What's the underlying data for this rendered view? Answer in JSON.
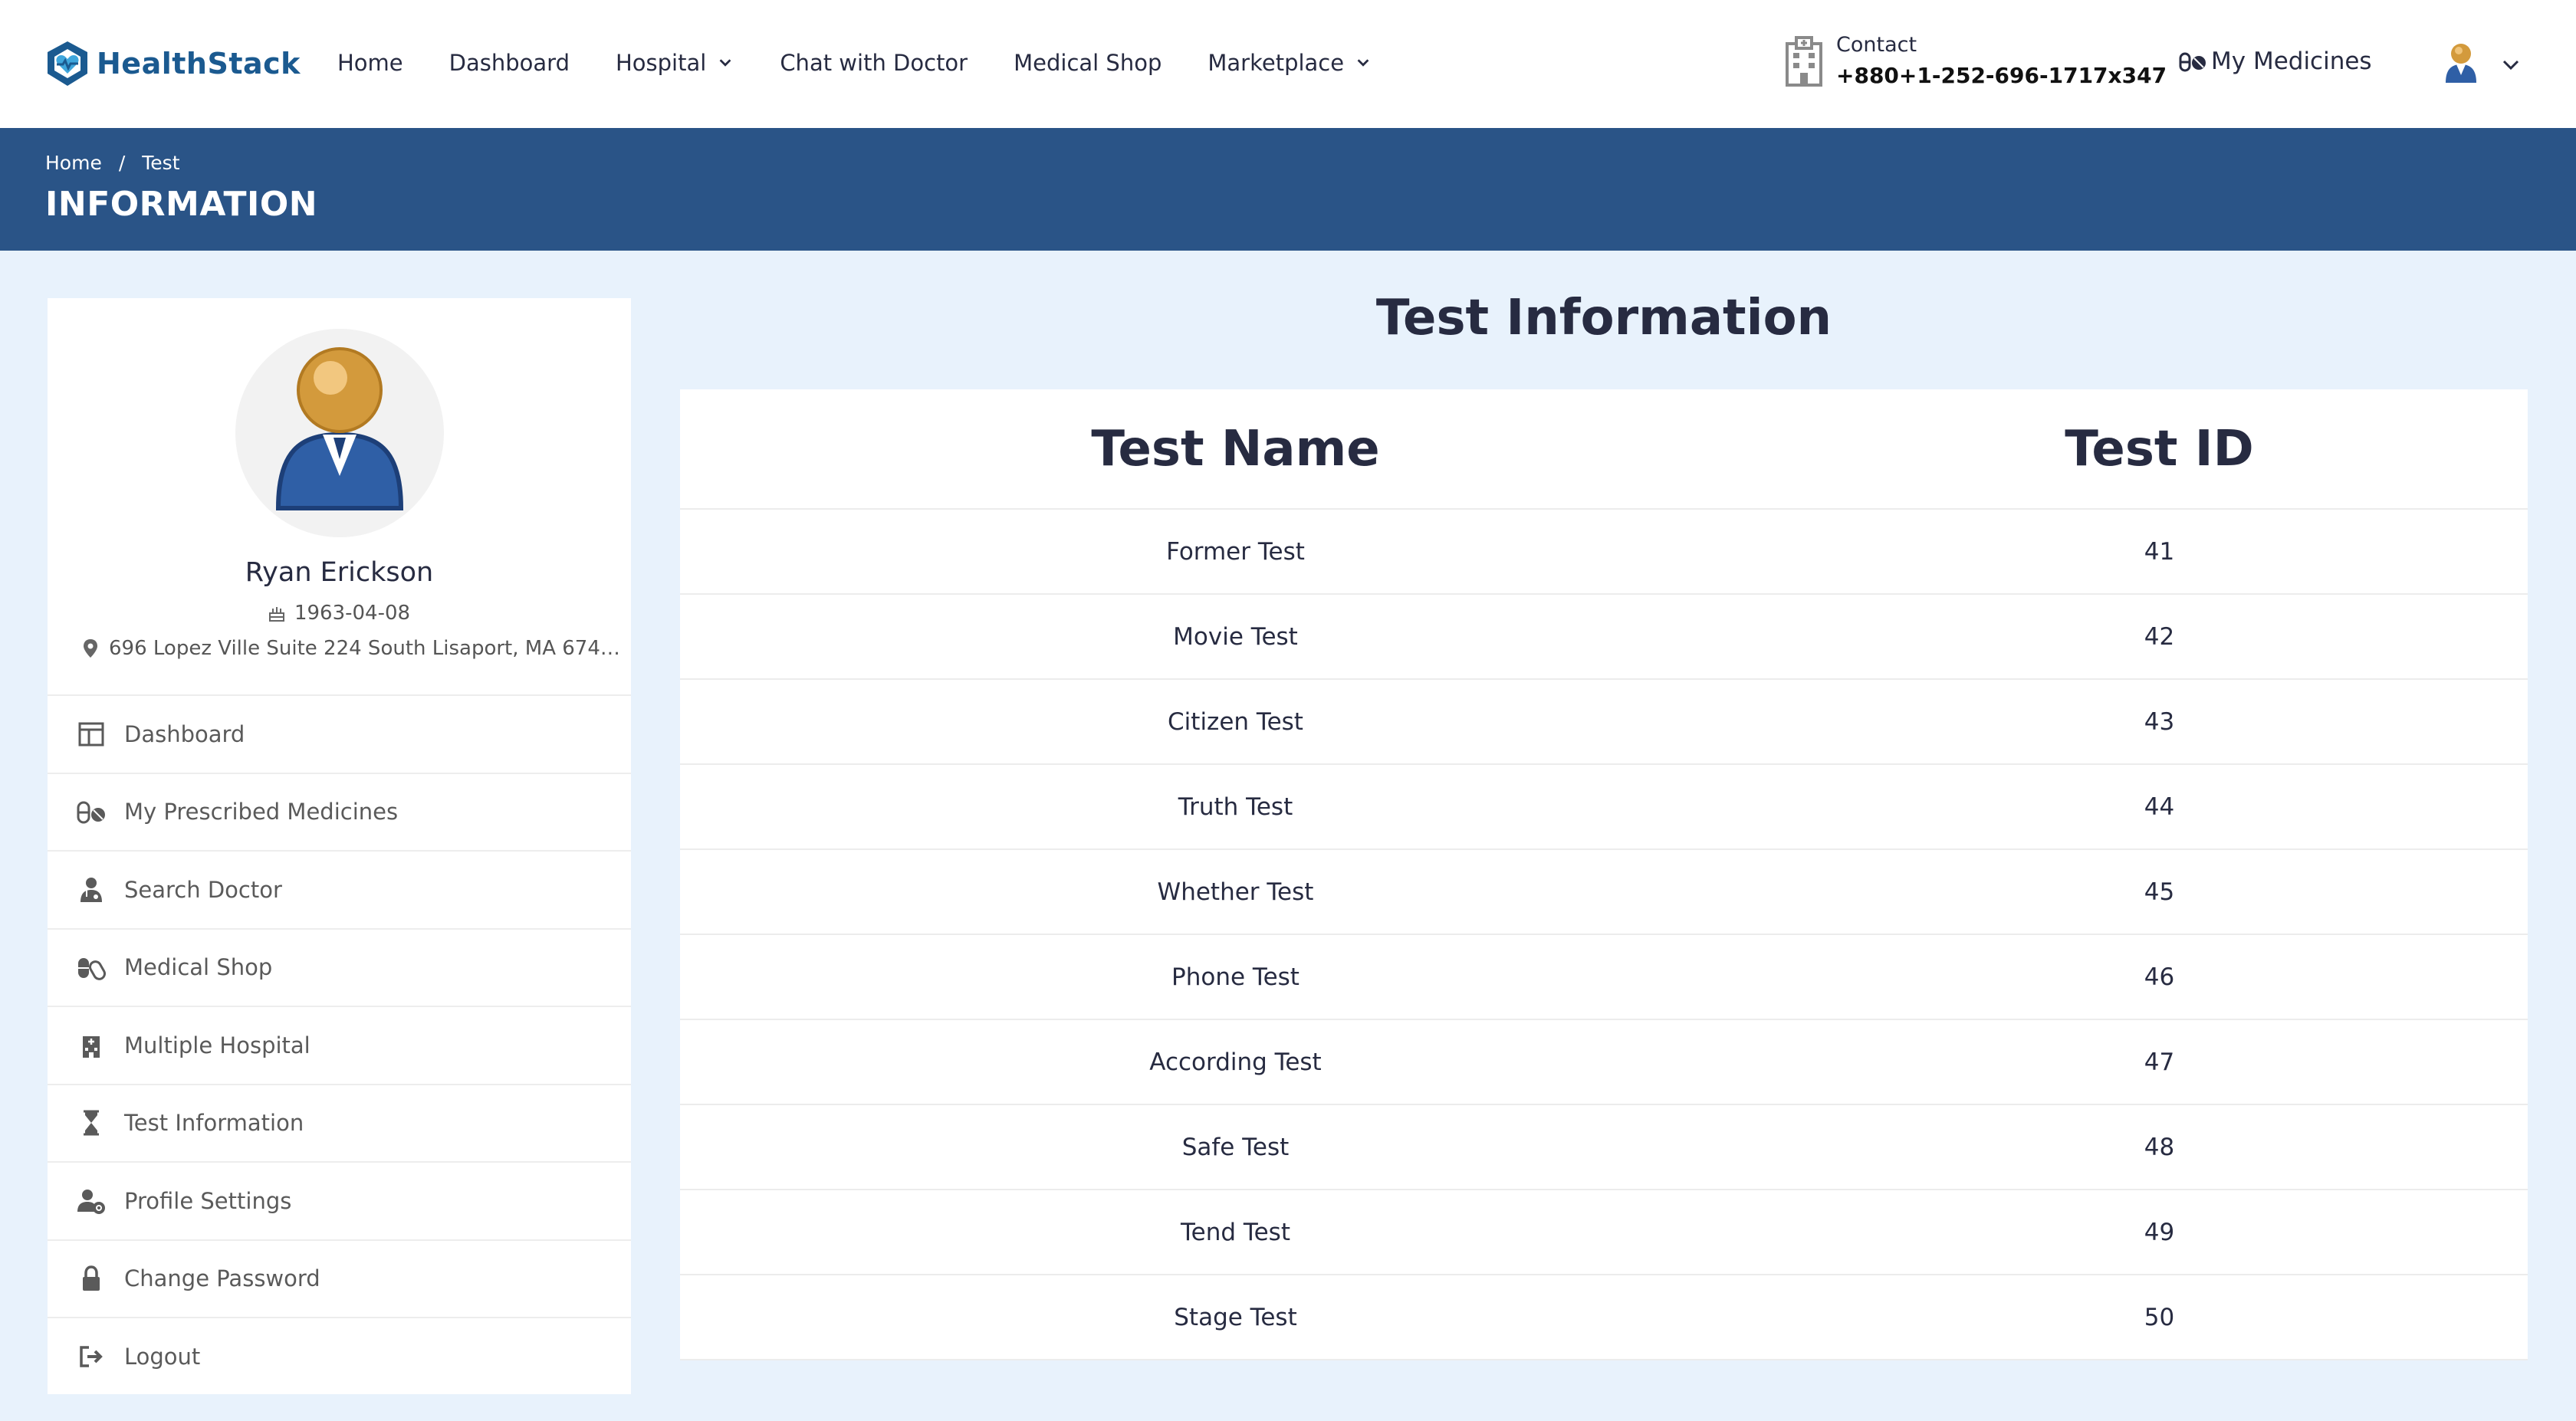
{
  "app": {
    "logo_text_1": "Health",
    "logo_text_2": "Stack",
    "brand_color": "#1b5a90",
    "banner_color": "#2a5487"
  },
  "nav": {
    "items": [
      "Home",
      "Dashboard",
      "Hospital",
      "Chat with Doctor",
      "Medical Shop",
      "Marketplace"
    ]
  },
  "contact": {
    "label": "Contact",
    "phone": "+880+1-252-696-1717x347"
  },
  "my_medicines": "My Medicines",
  "breadcrumb": {
    "home": "Home",
    "separator": "/",
    "current": "Test"
  },
  "banner_title": "INFORMATION",
  "profile": {
    "name": "Ryan Erickson",
    "dob": "1963-04-08",
    "address": "696 Lopez Ville Suite 224 South Lisaport, MA 674…"
  },
  "sidebar": {
    "items": [
      {
        "label": "Dashboard",
        "icon": "dashboard-icon"
      },
      {
        "label": "My Prescribed Medicines",
        "icon": "pills-icon"
      },
      {
        "label": "Search Doctor",
        "icon": "doctor-icon"
      },
      {
        "label": "Medical Shop",
        "icon": "capsules-icon"
      },
      {
        "label": "Multiple Hospital",
        "icon": "hospital-icon"
      },
      {
        "label": "Test Information",
        "icon": "hourglass-icon"
      },
      {
        "label": "Profile Settings",
        "icon": "user-cog-icon"
      },
      {
        "label": "Change Password",
        "icon": "lock-icon"
      },
      {
        "label": "Logout",
        "icon": "logout-icon"
      }
    ]
  },
  "main": {
    "title": "Test Information",
    "columns": [
      "Test Name",
      "Test ID"
    ],
    "rows": [
      [
        "Former Test",
        "41"
      ],
      [
        "Movie Test",
        "42"
      ],
      [
        "Citizen Test",
        "43"
      ],
      [
        "Truth Test",
        "44"
      ],
      [
        "Whether Test",
        "45"
      ],
      [
        "Phone Test",
        "46"
      ],
      [
        "According Test",
        "47"
      ],
      [
        "Safe Test",
        "48"
      ],
      [
        "Tend Test",
        "49"
      ],
      [
        "Stage Test",
        "50"
      ]
    ]
  }
}
